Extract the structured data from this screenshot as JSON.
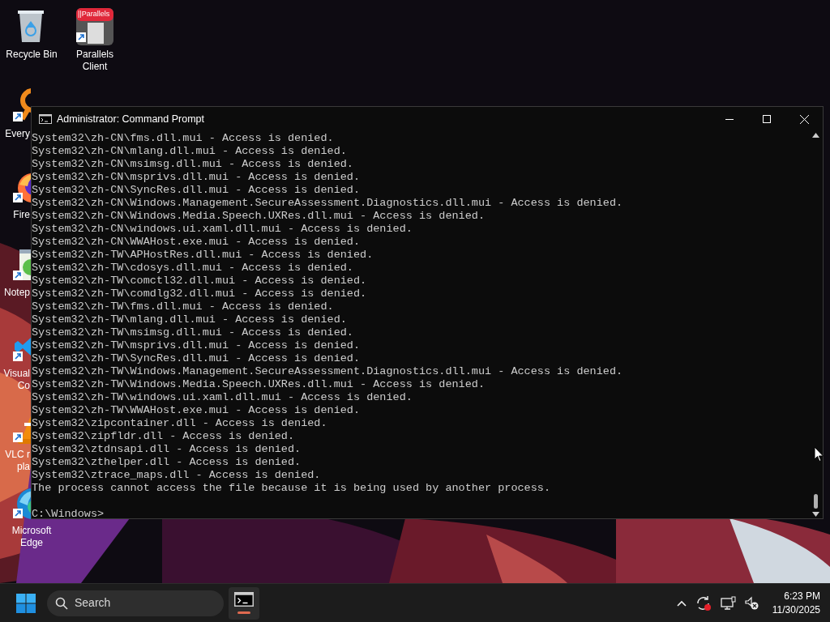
{
  "desktop_icons": [
    {
      "kind": "recycle-bin",
      "label": [
        "Recycle Bin"
      ]
    },
    {
      "kind": "parallels",
      "label": [
        "Parallels",
        "Client"
      ],
      "badge": "||Parallels"
    },
    {
      "kind": "everything",
      "label": [
        "Every"
      ]
    },
    {
      "kind": "firefox",
      "label": [
        "Fire"
      ]
    },
    {
      "kind": "notepad",
      "label": [
        "Notep"
      ]
    },
    {
      "kind": "vscode",
      "label": [
        "Visual",
        "Co"
      ]
    },
    {
      "kind": "vlc",
      "label": [
        "VLC r",
        "pla"
      ]
    },
    {
      "kind": "edge",
      "label": [
        "Microsoft",
        "Edge"
      ]
    }
  ],
  "window": {
    "title": "Administrator: Command Prompt",
    "lines": [
      "System32\\zh-CN\\fms.dll.mui - Access is denied.",
      "System32\\zh-CN\\mlang.dll.mui - Access is denied.",
      "System32\\zh-CN\\msimsg.dll.mui - Access is denied.",
      "System32\\zh-CN\\msprivs.dll.mui - Access is denied.",
      "System32\\zh-CN\\SyncRes.dll.mui - Access is denied.",
      "System32\\zh-CN\\Windows.Management.SecureAssessment.Diagnostics.dll.mui - Access is denied.",
      "System32\\zh-CN\\Windows.Media.Speech.UXRes.dll.mui - Access is denied.",
      "System32\\zh-CN\\windows.ui.xaml.dll.mui - Access is denied.",
      "System32\\zh-CN\\WWAHost.exe.mui - Access is denied.",
      "System32\\zh-TW\\APHostRes.dll.mui - Access is denied.",
      "System32\\zh-TW\\cdosys.dll.mui - Access is denied.",
      "System32\\zh-TW\\comctl32.dll.mui - Access is denied.",
      "System32\\zh-TW\\comdlg32.dll.mui - Access is denied.",
      "System32\\zh-TW\\fms.dll.mui - Access is denied.",
      "System32\\zh-TW\\mlang.dll.mui - Access is denied.",
      "System32\\zh-TW\\msimsg.dll.mui - Access is denied.",
      "System32\\zh-TW\\msprivs.dll.mui - Access is denied.",
      "System32\\zh-TW\\SyncRes.dll.mui - Access is denied.",
      "System32\\zh-TW\\Windows.Management.SecureAssessment.Diagnostics.dll.mui - Access is denied.",
      "System32\\zh-TW\\Windows.Media.Speech.UXRes.dll.mui - Access is denied.",
      "System32\\zh-TW\\windows.ui.xaml.dll.mui - Access is denied.",
      "System32\\zh-TW\\WWAHost.exe.mui - Access is denied.",
      "System32\\zipcontainer.dll - Access is denied.",
      "System32\\zipfldr.dll - Access is denied.",
      "System32\\ztdnsapi.dll - Access is denied.",
      "System32\\zthelper.dll - Access is denied.",
      "System32\\ztrace_maps.dll - Access is denied.",
      "The process cannot access the file because it is being used by another process."
    ],
    "prompt": "C:\\Windows>"
  },
  "taskbar": {
    "search": {
      "placeholder": "Search"
    },
    "apps": [
      {
        "kind": "terminal",
        "open": true
      }
    ],
    "clock": {
      "time": "6:23 PM",
      "date": "11/30/2025"
    }
  }
}
